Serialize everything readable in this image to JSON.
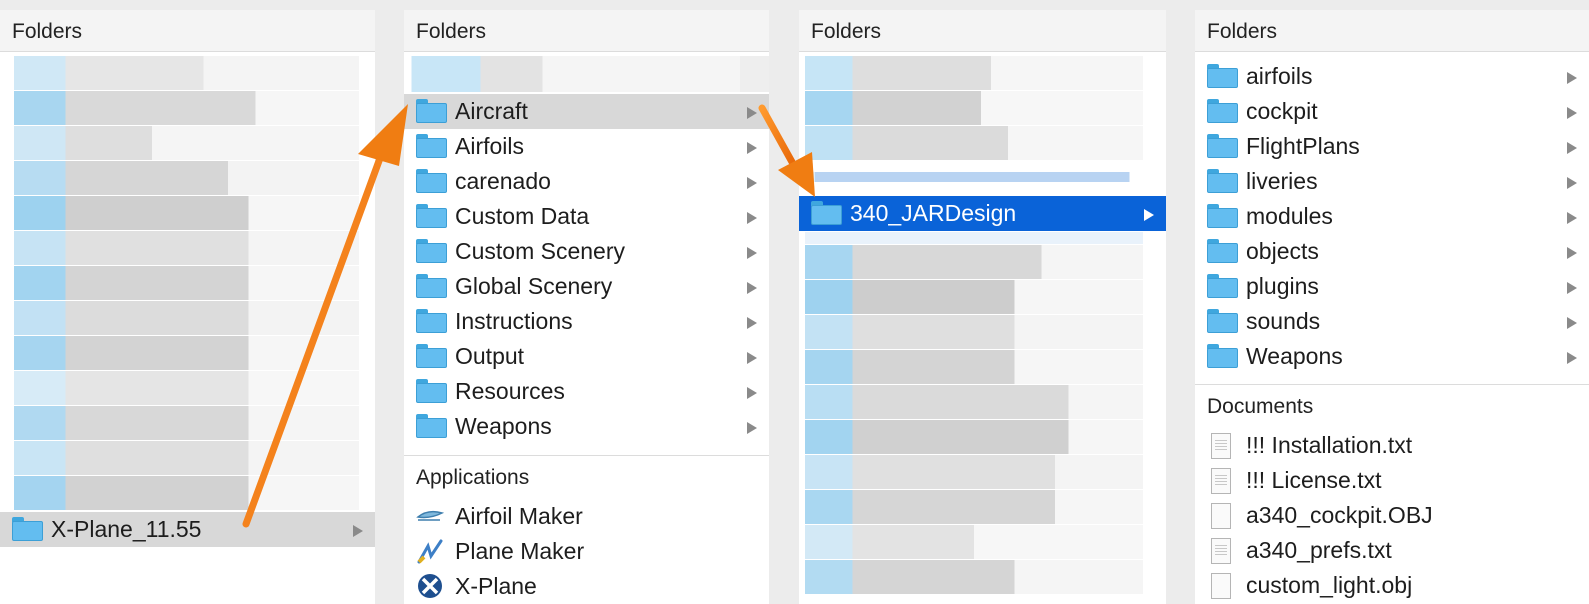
{
  "columns": [
    {
      "header": "Folders",
      "selected_item": {
        "label": "X-Plane_11.55",
        "icon": "folder-icon",
        "has_submenu": true
      }
    },
    {
      "header": "Folders",
      "items": [
        {
          "label": "Aircraft",
          "icon": "folder-icon",
          "has_submenu": true,
          "state": "highlighted"
        },
        {
          "label": "Airfoils",
          "icon": "folder-icon",
          "has_submenu": true
        },
        {
          "label": "carenado",
          "icon": "folder-icon",
          "has_submenu": true
        },
        {
          "label": "Custom Data",
          "icon": "folder-icon",
          "has_submenu": true
        },
        {
          "label": "Custom Scenery",
          "icon": "folder-icon",
          "has_submenu": true
        },
        {
          "label": "Global Scenery",
          "icon": "folder-icon",
          "has_submenu": true
        },
        {
          "label": "Instructions",
          "icon": "folder-icon",
          "has_submenu": true
        },
        {
          "label": "Output",
          "icon": "folder-icon",
          "has_submenu": true
        },
        {
          "label": "Resources",
          "icon": "folder-icon",
          "has_submenu": true
        },
        {
          "label": "Weapons",
          "icon": "folder-icon",
          "has_submenu": true
        }
      ],
      "applications_header": "Applications",
      "applications": [
        {
          "label": "Airfoil Maker",
          "icon": "airfoil-maker-icon"
        },
        {
          "label": "Plane Maker",
          "icon": "plane-maker-icon"
        },
        {
          "label": "X-Plane",
          "icon": "x-plane-icon"
        }
      ]
    },
    {
      "header": "Folders",
      "selected_item": {
        "label": "340_JARDesign",
        "icon": "folder-icon",
        "has_submenu": true,
        "state": "selected"
      }
    },
    {
      "header": "Folders",
      "items": [
        {
          "label": "airfoils",
          "icon": "folder-icon",
          "has_submenu": true
        },
        {
          "label": "cockpit",
          "icon": "folder-icon",
          "has_submenu": true
        },
        {
          "label": "FlightPlans",
          "icon": "folder-icon",
          "has_submenu": true
        },
        {
          "label": "liveries",
          "icon": "folder-icon",
          "has_submenu": true
        },
        {
          "label": "modules",
          "icon": "folder-icon",
          "has_submenu": true
        },
        {
          "label": "objects",
          "icon": "folder-icon",
          "has_submenu": true
        },
        {
          "label": "plugins",
          "icon": "folder-icon",
          "has_submenu": true
        },
        {
          "label": "sounds",
          "icon": "folder-icon",
          "has_submenu": true
        },
        {
          "label": "Weapons",
          "icon": "folder-icon",
          "has_submenu": true
        }
      ],
      "documents_header": "Documents",
      "documents": [
        {
          "label": "!!! Installation.txt",
          "icon": "text-document-icon"
        },
        {
          "label": "!!! License.txt",
          "icon": "text-document-icon"
        },
        {
          "label": "a340_cockpit.OBJ",
          "icon": "blank-document-icon"
        },
        {
          "label": "a340_prefs.txt",
          "icon": "text-document-icon"
        },
        {
          "label": "custom_light.obj",
          "icon": "blank-document-icon"
        }
      ]
    }
  ],
  "colors": {
    "selection": "#0a63d8",
    "highlight": "#d8d8d8",
    "folder": "#63bdf0",
    "annotation_arrow": "#f07d12"
  }
}
